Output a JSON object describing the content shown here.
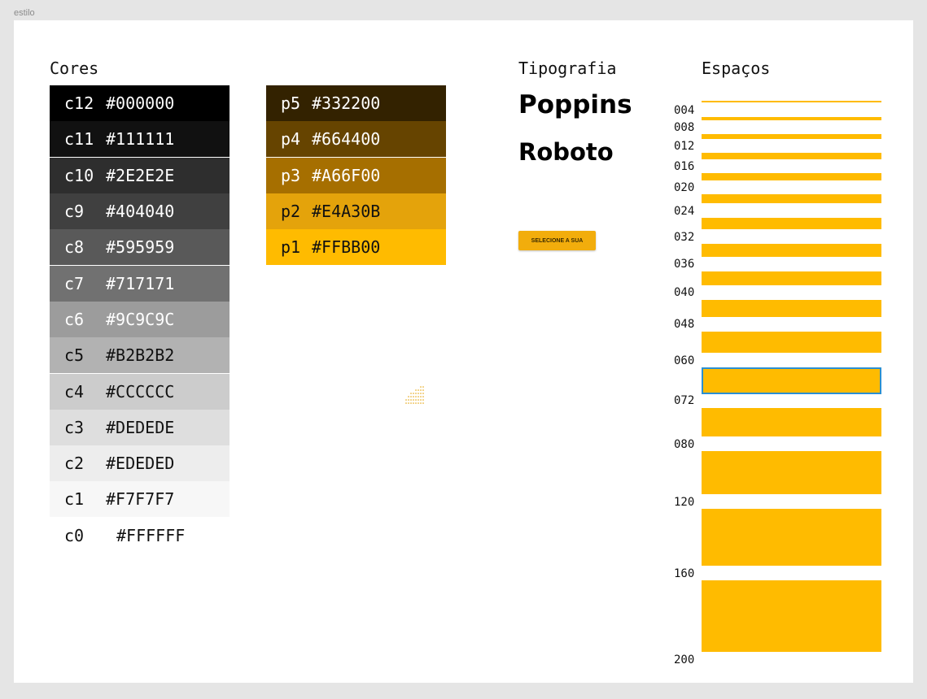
{
  "frame_label": "estilo",
  "sections": {
    "colors": "Cores",
    "typography": "Tipografia",
    "spacing": "Espaços"
  },
  "grays": [
    {
      "code": "c12",
      "hex": "#000000",
      "text": "#ffffff"
    },
    {
      "code": "c11",
      "hex": "#111111",
      "text": "#ffffff"
    },
    {
      "code": "c10",
      "hex": "#2E2E2E",
      "text": "#ffffff"
    },
    {
      "code": "c9",
      "hex": "#404040",
      "text": "#ffffff"
    },
    {
      "code": "c8",
      "hex": "#595959",
      "text": "#ffffff"
    },
    {
      "code": "c7",
      "hex": "#717171",
      "text": "#ffffff"
    },
    {
      "code": "c6",
      "hex": "#9C9C9C",
      "text": "#ffffff"
    },
    {
      "code": "c5",
      "hex": "#B2B2B2",
      "text": "#111111"
    },
    {
      "code": "c4",
      "hex": "#CCCCCC",
      "text": "#111111"
    },
    {
      "code": "c3",
      "hex": "#DEDEDE",
      "text": "#111111"
    },
    {
      "code": "c2",
      "hex": "#EDEDED",
      "text": "#111111"
    },
    {
      "code": "c1",
      "hex": "#F7F7F7",
      "text": "#111111"
    },
    {
      "code": "c0",
      "hex": "#FFFFFF",
      "text": "#111111"
    }
  ],
  "primaries": [
    {
      "code": "p5",
      "hex": "#332200",
      "text": "#ffffff"
    },
    {
      "code": "p4",
      "hex": "#664400",
      "text": "#ffffff"
    },
    {
      "code": "p3",
      "hex": "#A66F00",
      "text": "#ffffff"
    },
    {
      "code": "p2",
      "hex": "#E4A30B",
      "text": "#111111"
    },
    {
      "code": "p1",
      "hex": "#FFBB00",
      "text": "#111111"
    }
  ],
  "typography": {
    "font1": "Poppins",
    "font2": "Roboto",
    "button_label": "SELECIONE A SUA"
  },
  "spacing": [
    {
      "label": "004",
      "value": 4
    },
    {
      "label": "008",
      "value": 8
    },
    {
      "label": "012",
      "value": 12
    },
    {
      "label": "016",
      "value": 16
    },
    {
      "label": "020",
      "value": 20
    },
    {
      "label": "024",
      "value": 24
    },
    {
      "label": "032",
      "value": 32
    },
    {
      "label": "036",
      "value": 36
    },
    {
      "label": "040",
      "value": 40
    },
    {
      "label": "048",
      "value": 48
    },
    {
      "label": "060",
      "value": 60
    },
    {
      "label": "072",
      "value": 72
    },
    {
      "label": "080",
      "value": 80
    },
    {
      "label": "120",
      "value": 120
    },
    {
      "label": "160",
      "value": 160
    },
    {
      "label": "200",
      "value": 200
    }
  ],
  "accent_color": "#FFBB00",
  "selection_color": "#2B8FD1"
}
